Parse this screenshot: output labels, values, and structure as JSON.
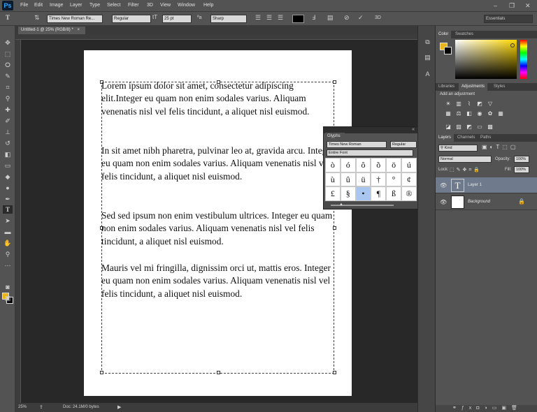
{
  "app": {
    "logo": "Ps"
  },
  "menu": [
    "File",
    "Edit",
    "Image",
    "Layer",
    "Type",
    "Select",
    "Filter",
    "3D",
    "View",
    "Window",
    "Help"
  ],
  "window_controls": {
    "minimize": "–",
    "restore": "❐",
    "close": "✕"
  },
  "options": {
    "tool_icon": "T",
    "font_family": "Times New Roman Re...",
    "font_style": "Regular",
    "font_size": "25 pt",
    "aa_label": "ªa",
    "antialias": "Sharp",
    "color": "#000000",
    "workspace": "Essentials",
    "icons": [
      "orient-icon",
      "align-left-icon",
      "align-center-icon",
      "align-right-icon",
      "warp-icon",
      "panels-icon",
      "cancel-icon",
      "commit-icon",
      "3d-icon"
    ]
  },
  "document": {
    "tab_title": "Untitled-1 @ 25% (RGB/8) *",
    "close": "×",
    "paragraphs": [
      "Lorem ipsum dolor sit amet, consectetur adipiscing elit.Integer eu quam non enim sodales varius. Aliquam venenatis nisl vel felis tincidunt, a aliquet nisl euismod.",
      "In sit amet nibh pharetra, pulvinar leo at, gravida arcu. Integer eu quam non enim sodales varius. Aliquam venenatis nisl vel felis tincidunt, a aliquet nisl euismod.",
      "Sed sed ipsum non enim vestibulum ultrices. Integer eu quam non enim sodales varius. Aliquam venenatis nisl vel felis tincidunt, a aliquet nisl euismod.",
      "Mauris vel mi fringilla, dignissim orci ut, mattis eros. Integer eu quam non enim sodales varius. Aliquam venenatis nisl vel felis tincidunt, a aliquet nisl euismod."
    ]
  },
  "status": {
    "zoom": "25%",
    "doc": "Doc: 24.1M/0 bytes"
  },
  "glyphs": {
    "title": "Glyphs",
    "font": "Times New Roman",
    "style": "Regular",
    "show": "Entire Font",
    "cells": [
      "ò",
      "ó",
      "ô",
      "õ",
      "ö",
      "ú",
      "ù",
      "û",
      "ü",
      "†",
      "°",
      "¢",
      "£",
      "§",
      "•",
      "¶",
      "ß",
      "®"
    ],
    "selected_index": 14
  },
  "panels": {
    "color_tabs": [
      "Color",
      "Swatches"
    ],
    "adjust_tabs": [
      "Libraries",
      "Adjustments",
      "Styles"
    ],
    "add_adjustment": "Add an adjustment",
    "layer_tabs": [
      "Layers",
      "Channels",
      "Paths"
    ],
    "kind": "Kind",
    "blend_mode": "Normal",
    "opacity_label": "Opacity:",
    "opacity": "100%",
    "lock_label": "Lock:",
    "fill_label": "Fill:",
    "fill": "100%",
    "layers": [
      {
        "name": "Layer 1",
        "thumb": "T",
        "selected": true
      },
      {
        "name": "Background",
        "thumb": "",
        "locked": true,
        "selected": false
      }
    ]
  },
  "colors": {
    "foreground": "#e8b61c",
    "background": "#000000",
    "selection": "#6f7b8c"
  }
}
